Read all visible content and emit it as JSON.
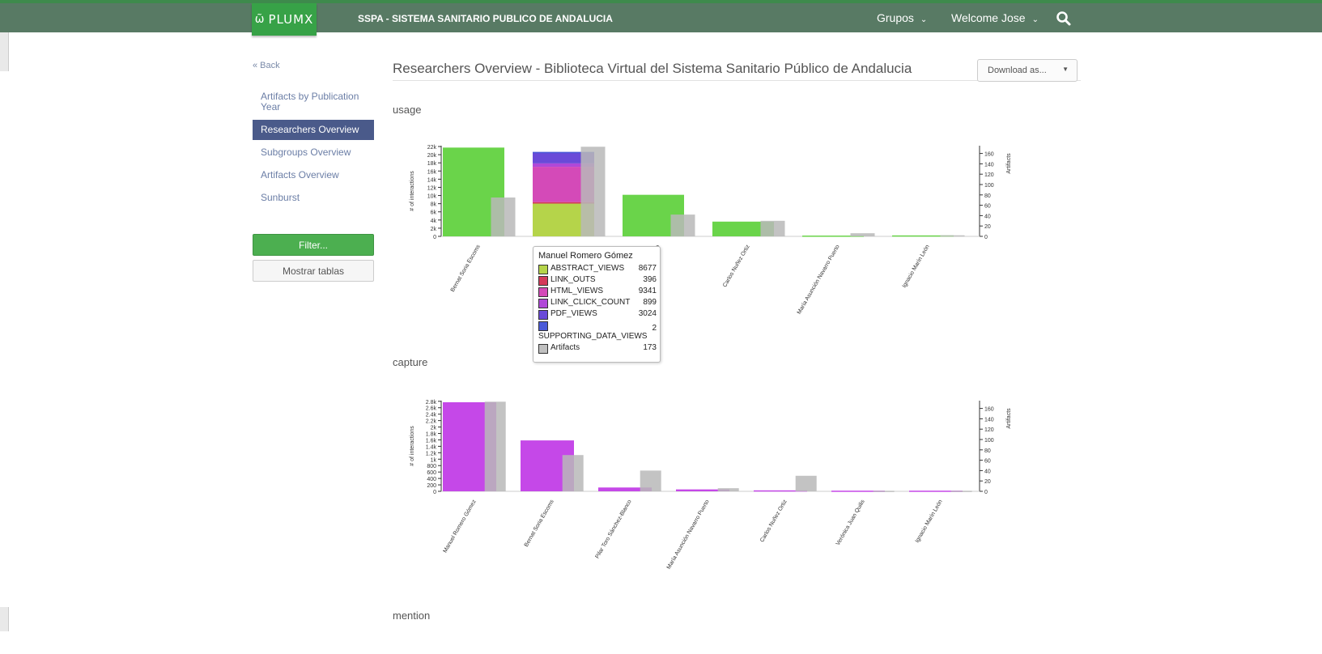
{
  "header": {
    "logo_text": "PLUMX",
    "site_title": "SSPA - SISTEMA SANITARIO PUBLICO DE ANDALUCIA",
    "groups_label": "Grupos",
    "user_label": "Welcome Jose"
  },
  "sidebar": {
    "back_label": "« Back",
    "items": [
      {
        "label": "Artifacts by Publication Year"
      },
      {
        "label": "Researchers Overview"
      },
      {
        "label": "Subgroups Overview"
      },
      {
        "label": "Artifacts Overview"
      },
      {
        "label": "Sunburst"
      }
    ],
    "filter_label": "Filter...",
    "tables_label": "Mostrar tablas"
  },
  "main": {
    "title": "Researchers Overview - Biblioteca Virtual del Sistema Sanitario Público de Andalucia",
    "download_label": "Download as...",
    "sections": [
      "usage",
      "capture",
      "mention"
    ]
  },
  "tooltip": {
    "title": "Manuel Romero Gómez",
    "rows": [
      {
        "label": "ABSTRACT_VIEWS",
        "value": "8677",
        "color": "#b5d44a"
      },
      {
        "label": "LINK_OUTS",
        "value": "396",
        "color": "#d43a5a"
      },
      {
        "label": "HTML_VIEWS",
        "value": "9341",
        "color": "#d44ab8"
      },
      {
        "label": "LINK_CLICK_COUNT",
        "value": "899",
        "color": "#b048d8"
      },
      {
        "label": "PDF_VIEWS",
        "value": "3024",
        "color": "#6a4ad8"
      },
      {
        "label": "SUPPORTING_DATA_VIEWS",
        "value": "2",
        "color": "#4a5ad8"
      },
      {
        "label": "Artifacts",
        "value": "173",
        "color": "#c0c0c0"
      }
    ]
  },
  "chart_data": [
    {
      "type": "bar",
      "name": "usage",
      "ylabel": "# of interactions",
      "y2label": "Artifacts",
      "ylim": [
        0,
        24000
      ],
      "y2lim": [
        0,
        175
      ],
      "yticks": [
        "0",
        "2k",
        "4k",
        "6k",
        "8k",
        "10k",
        "12k",
        "14k",
        "16k",
        "18k",
        "20k",
        "22k"
      ],
      "y2ticks": [
        "0",
        "20",
        "40",
        "60",
        "80",
        "100",
        "120",
        "140",
        "160"
      ],
      "categories": [
        "Bernat Soria Escoms",
        "Manuel Romero Gómez",
        "Pilar Toro Sánchez-Blanco",
        "Carlos Nuñez Ortiz",
        "María Asunción Navarro Puerto",
        "Ignacio Marín León"
      ],
      "category_labels_visible": [
        "Bernat Soria Escoms",
        "",
        "…ez-Blanco",
        "Carlos Nuñez Ortiz",
        "María Asunción Navarro Puerto",
        "Ignacio Marín León"
      ],
      "series": [
        {
          "name": "ABSTRACT_VIEWS",
          "color": "#b5d44a",
          "values": [
            0,
            8677,
            0,
            0,
            0,
            0
          ]
        },
        {
          "name": "LINK_OUTS",
          "color": "#d43a5a",
          "values": [
            0,
            396,
            0,
            0,
            0,
            0
          ]
        },
        {
          "name": "HTML_VIEWS",
          "color": "#d44ab8",
          "values": [
            0,
            9341,
            0,
            0,
            0,
            0
          ]
        },
        {
          "name": "LINK_CLICK_COUNT",
          "color": "#b048d8",
          "values": [
            0,
            899,
            0,
            0,
            0,
            0
          ]
        },
        {
          "name": "PDF_VIEWS",
          "color": "#6a4ad8",
          "values": [
            0,
            3024,
            0,
            0,
            0,
            0
          ]
        },
        {
          "name": "SUPPORTING_DATA_VIEWS",
          "color": "#4a5ad8",
          "values": [
            0,
            2,
            0,
            0,
            0,
            0
          ]
        },
        {
          "name": "",
          "color": "#6ad44a",
          "values": [
            23500,
            0,
            11000,
            3900,
            200,
            250
          ]
        }
      ],
      "artifacts": [
        75,
        173,
        42,
        30,
        6,
        2
      ],
      "artifact_color": "#b8b8b8"
    },
    {
      "type": "bar",
      "name": "capture",
      "ylabel": "# of interactions",
      "y2label": "Artifacts",
      "ylim": [
        0,
        2850
      ],
      "y2lim": [
        0,
        175
      ],
      "yticks": [
        "0",
        "200",
        "400",
        "600",
        "800",
        "1k",
        "1.2k",
        "1.4k",
        "1.6k",
        "1.8k",
        "2k",
        "2.2k",
        "2.4k",
        "2.6k",
        "2.8k"
      ],
      "y2ticks": [
        "0",
        "20",
        "40",
        "60",
        "80",
        "100",
        "120",
        "140",
        "160"
      ],
      "categories": [
        "Manuel Romero Gómez",
        "Bernat Soria Escoms",
        "Pilar Toro Sánchez-Blanco",
        "María Asunción Navarro Puerto",
        "Carlos Nuñez Ortiz",
        "Verónica Juan Quilis",
        "Ignacio Marín León"
      ],
      "series": [
        {
          "name": "",
          "color": "#c548e8",
          "values": [
            2800,
            1600,
            120,
            60,
            30,
            20,
            20
          ]
        }
      ],
      "artifacts": [
        173,
        70,
        40,
        6,
        30,
        1,
        1
      ],
      "artifact_color": "#b8b8b8"
    }
  ]
}
